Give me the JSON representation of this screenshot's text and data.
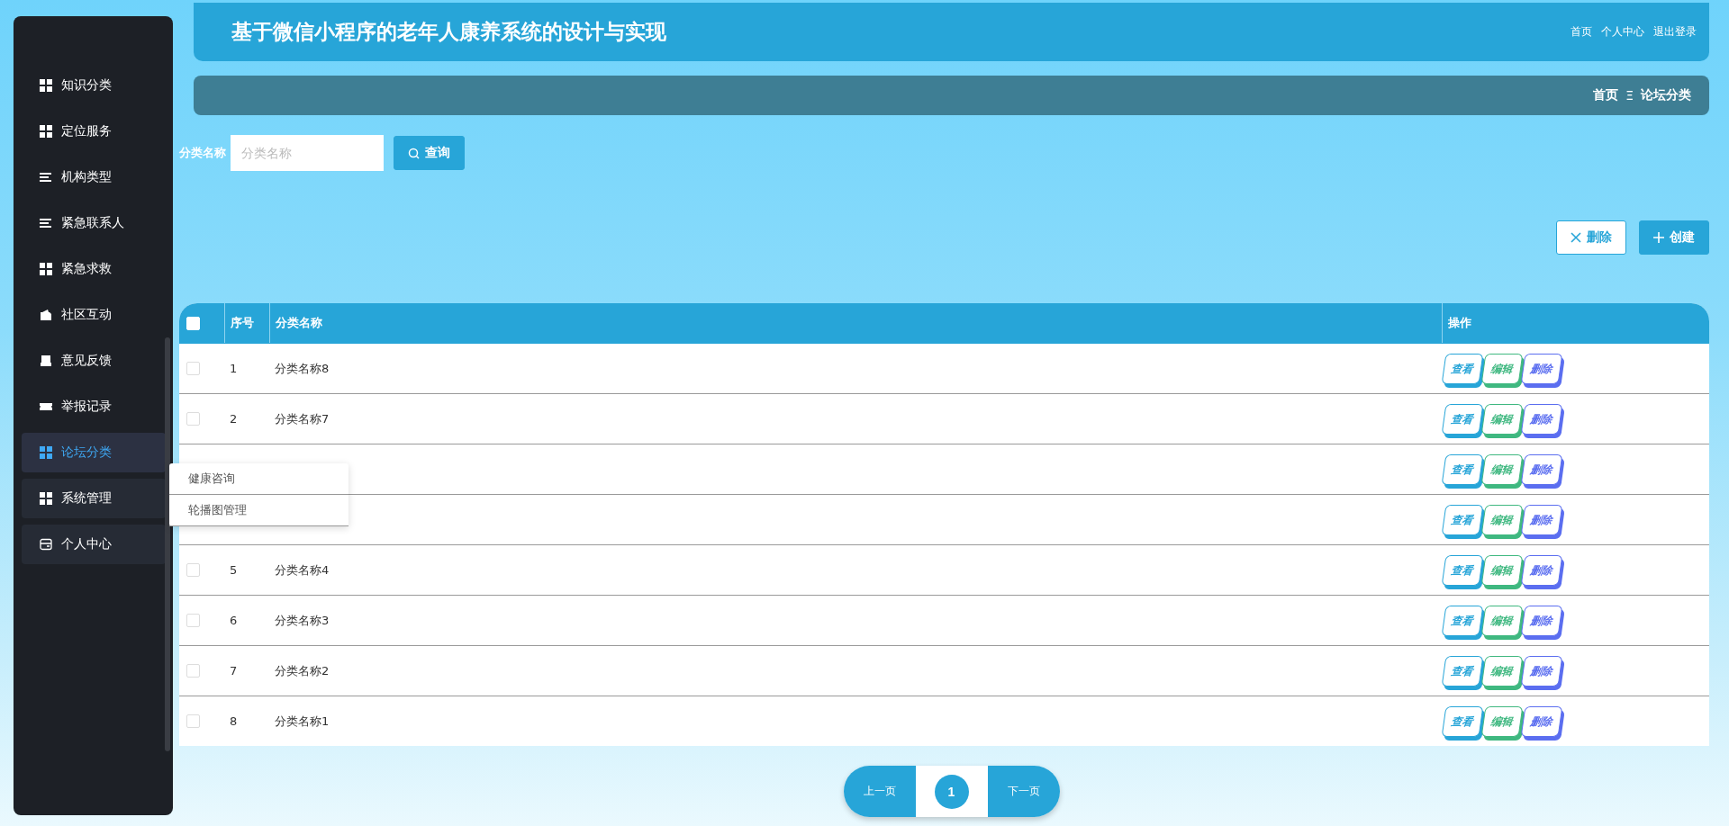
{
  "sidebar": {
    "items": [
      {
        "label": "知识分类",
        "selected": false,
        "hovered": false
      },
      {
        "label": "定位服务",
        "selected": false,
        "hovered": false
      },
      {
        "label": "机构类型",
        "selected": false,
        "hovered": false
      },
      {
        "label": "紧急联系人",
        "selected": false,
        "hovered": false
      },
      {
        "label": "紧急求救",
        "selected": false,
        "hovered": false
      },
      {
        "label": "社区互动",
        "selected": false,
        "hovered": false
      },
      {
        "label": "意见反馈",
        "selected": false,
        "hovered": false
      },
      {
        "label": "举报记录",
        "selected": false,
        "hovered": false
      },
      {
        "label": "论坛分类",
        "selected": true,
        "hovered": false
      },
      {
        "label": "系统管理",
        "selected": false,
        "hovered": true
      },
      {
        "label": "个人中心",
        "selected": false,
        "hovered": true
      }
    ],
    "submenu": [
      "健康咨询",
      "轮播图管理"
    ]
  },
  "header": {
    "title": "基于微信小程序的老年人康养系统的设计与实现",
    "links": [
      "首页",
      "个人中心",
      "退出登录"
    ]
  },
  "breadcrumb": {
    "home": "首页",
    "separator": "Ξ",
    "current": "论坛分类"
  },
  "search": {
    "label": "分类名称",
    "placeholder": "分类名称",
    "button": "查询"
  },
  "actions": {
    "delete": "删除",
    "create": "创建"
  },
  "table": {
    "columns": [
      "序号",
      "分类名称",
      "操作"
    ],
    "header_checked": false,
    "rows": [
      {
        "checked": false,
        "index": "1",
        "name": "分类名称8",
        "buttons": [
          "查看",
          "编辑",
          "删除"
        ]
      },
      {
        "checked": false,
        "index": "2",
        "name": "分类名称7",
        "buttons": [
          "查看",
          "编辑",
          "删除"
        ]
      },
      {
        "buttons": [
          "查看",
          "编辑",
          "删除"
        ]
      },
      {
        "buttons": [
          "查看",
          "编辑",
          "删除"
        ]
      },
      {
        "checked": false,
        "index": "5",
        "name": "分类名称4",
        "buttons": [
          "查看",
          "编辑",
          "删除"
        ]
      },
      {
        "checked": false,
        "index": "6",
        "name": "分类名称3",
        "buttons": [
          "查看",
          "编辑",
          "删除"
        ]
      },
      {
        "checked": false,
        "index": "7",
        "name": "分类名称2",
        "buttons": [
          "查看",
          "编辑",
          "删除"
        ]
      },
      {
        "checked": false,
        "index": "8",
        "name": "分类名称1",
        "buttons": [
          "查看",
          "编辑",
          "删除"
        ]
      }
    ]
  },
  "pagination": {
    "prev": "上一页",
    "pages": [
      {
        "label": "1",
        "selected": true
      }
    ],
    "next": "下一页"
  }
}
